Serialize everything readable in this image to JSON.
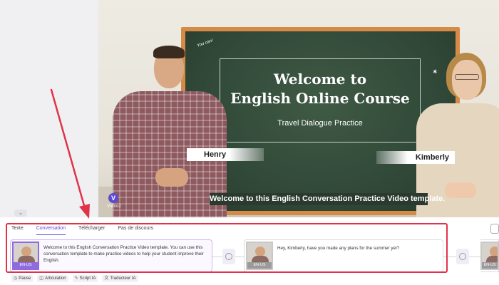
{
  "stage": {
    "board_title_line1": "Welcome to",
    "board_title_line2": "English Online Course",
    "board_subtitle": "Travel Dialogue Practice",
    "board_doodle": "You can!",
    "caption": "Welcome to this English Conversation Practice Video template.",
    "name_left": "Henry",
    "name_right": "Kimberly",
    "logo_letter": "V",
    "logo_text": "Vidnoz"
  },
  "editor": {
    "tabs": [
      {
        "label": "Texte"
      },
      {
        "label": "Conversation"
      },
      {
        "label": "Télécharger"
      },
      {
        "label": "Pas de discours"
      }
    ],
    "active_tab": "Conversation",
    "cards": [
      {
        "lang": "EN-US",
        "text": "Welcome to this English Conversation Practice Video template. You can use this conversation template to make practice videos to help your student improve their English."
      },
      {
        "lang": "EN-US",
        "text": "Hey, Kimberly, have you made any plans for the summer yet?"
      },
      {
        "lang": "EN-US",
        "text": ""
      }
    ],
    "toolbar": [
      {
        "label": "Pause",
        "icon": "clock-icon"
      },
      {
        "label": "Articulation",
        "icon": "articulation-icon"
      },
      {
        "label": "Script IA",
        "icon": "script-icon"
      },
      {
        "label": "Traducteur IA",
        "icon": "translate-icon"
      }
    ]
  },
  "colors": {
    "accent": "#5b4bd3",
    "highlight": "#e0334a",
    "board": "#2f4636",
    "frame": "#d58a45"
  }
}
